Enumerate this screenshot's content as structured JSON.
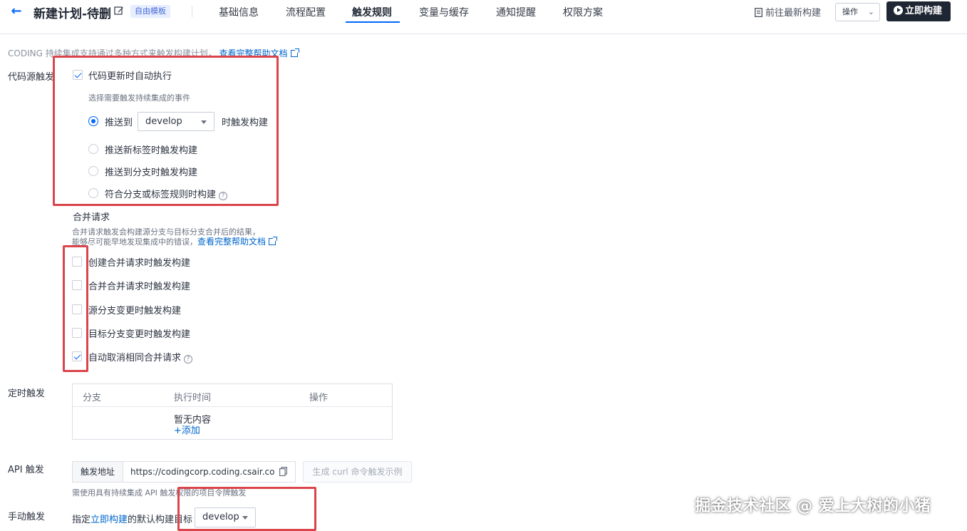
{
  "header": {
    "title": "新建计划-待删",
    "template_badge": "自由模板",
    "tabs": [
      {
        "label": "基础信息"
      },
      {
        "label": "流程配置"
      },
      {
        "label": "触发规则"
      },
      {
        "label": "变量与缓存"
      },
      {
        "label": "通知提醒"
      },
      {
        "label": "权限方案"
      }
    ],
    "active_tab": "触发规则",
    "goto_latest": "前往最新构建",
    "ops_label": "操作",
    "build_now": "立即构建"
  },
  "intro": {
    "text": "CODING 持续集成支持通过多种方式来触发构建计划，",
    "link": "查看完整帮助文档"
  },
  "code_trigger": {
    "label": "代码源触发",
    "auto_run": {
      "label": "代码更新时自动执行",
      "checked": true
    },
    "hint": "选择需要触发持续集成的事件",
    "push_to": {
      "prefix": "推送到",
      "branch": "develop",
      "suffix": "时触发构建",
      "selected": true
    },
    "options": [
      {
        "label": "推送新标签时触发构建",
        "selected": false
      },
      {
        "label": "推送到分支时触发构建",
        "selected": false
      },
      {
        "label": "符合分支或标签规则时构建",
        "selected": false
      }
    ]
  },
  "merge_request": {
    "title": "合并请求",
    "desc_line1": "合并请求触发会构建源分支与目标分支合并后的结果，",
    "desc_line2": "能够尽可能早地发现集成中的错误，",
    "link": "查看完整帮助文档",
    "options": [
      {
        "label": "创建合并请求时触发构建",
        "checked": false
      },
      {
        "label": "合并合并请求时触发构建",
        "checked": false
      },
      {
        "label": "源分支变更时触发构建",
        "checked": false
      },
      {
        "label": "目标分支变更时触发构建",
        "checked": false
      },
      {
        "label": "自动取消相同合并请求",
        "checked": true
      }
    ]
  },
  "schedule": {
    "label": "定时触发",
    "columns": [
      "分支",
      "执行时间",
      "操作"
    ],
    "empty": "暂无内容",
    "add": "添加"
  },
  "api_trigger": {
    "label": "API 触发",
    "url_label": "触发地址",
    "url": "https://codingcorp.coding.csair.co",
    "gen_curl": "生成 curl 命令触发示例",
    "note": "需使用具有持续集成 API 触发权限的项目令牌触发"
  },
  "manual_trigger": {
    "label": "手动触发",
    "prefix": "指定",
    "link": "立即构建",
    "suffix": "的默认构建目标",
    "branch": "develop"
  },
  "watermark": "掘金技术社区 @ 爱上大树的小猪",
  "colors": {
    "accent": "#0066ff",
    "highlight_box": "#d9454b",
    "build_button": "#1f2633",
    "badge_bg": "#e6eeff"
  }
}
